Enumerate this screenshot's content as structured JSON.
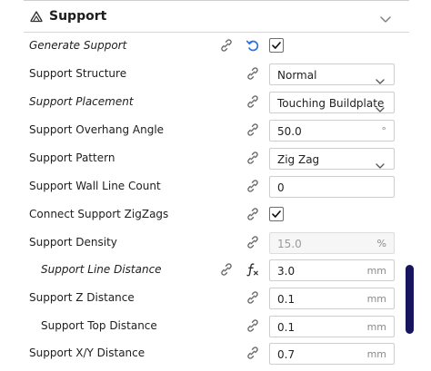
{
  "section": {
    "title": "Support",
    "icons": {
      "section": "support-icon",
      "collapse": "chevron-down-icon"
    }
  },
  "rows": [
    {
      "label": "Generate Support",
      "italic": true,
      "indent": false,
      "control": "checkbox",
      "checked": true,
      "icons": [
        "link-icon",
        "reset-icon"
      ]
    },
    {
      "label": "Support Structure",
      "italic": false,
      "indent": false,
      "control": "select",
      "value": "Normal",
      "icons": [
        "link-icon"
      ]
    },
    {
      "label": "Support Placement",
      "italic": true,
      "indent": false,
      "control": "select",
      "value": "Touching Buildplate",
      "icons": [
        "link-icon"
      ]
    },
    {
      "label": "Support Overhang Angle",
      "italic": false,
      "indent": false,
      "control": "number",
      "value": "50.0",
      "unit": "°",
      "icons": [
        "link-icon"
      ]
    },
    {
      "label": "Support Pattern",
      "italic": false,
      "indent": false,
      "control": "select",
      "value": "Zig Zag",
      "icons": [
        "link-icon"
      ]
    },
    {
      "label": "Support Wall Line Count",
      "italic": false,
      "indent": false,
      "control": "number",
      "value": "0",
      "unit": "",
      "icons": [
        "link-icon"
      ]
    },
    {
      "label": "Connect Support ZigZags",
      "italic": false,
      "indent": false,
      "control": "checkbox",
      "checked": true,
      "icons": [
        "link-icon"
      ]
    },
    {
      "label": "Support Density",
      "italic": false,
      "indent": false,
      "control": "number",
      "value": "15.0",
      "unit": "%",
      "disabled": true,
      "icons": [
        "link-icon"
      ]
    },
    {
      "label": "Support Line Distance",
      "italic": true,
      "indent": true,
      "control": "number",
      "value": "3.0",
      "unit": "mm",
      "icons": [
        "link-icon",
        "formula-icon"
      ]
    },
    {
      "label": "Support Z Distance",
      "italic": false,
      "indent": false,
      "control": "number",
      "value": "0.1",
      "unit": "mm",
      "icons": [
        "link-icon"
      ]
    },
    {
      "label": "Support Top Distance",
      "italic": false,
      "indent": true,
      "control": "number",
      "value": "0.1",
      "unit": "mm",
      "icons": [
        "link-icon"
      ]
    },
    {
      "label": "Support X/Y Distance",
      "italic": false,
      "indent": false,
      "control": "number",
      "value": "0.7",
      "unit": "mm",
      "icons": [
        "link-icon"
      ]
    }
  ],
  "colors": {
    "accent": "#17155e",
    "reset": "#2f6fdf",
    "icon": "#6a6a6a"
  }
}
